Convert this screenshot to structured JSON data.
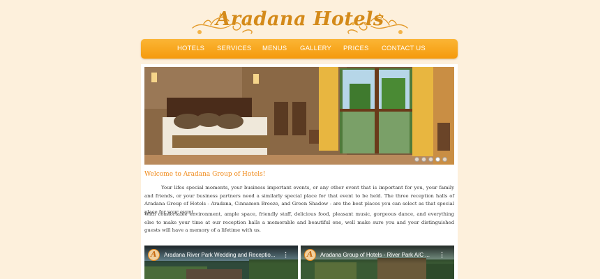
{
  "brand": {
    "name": "Aradana Hotels"
  },
  "nav": {
    "items": [
      {
        "label": "HOTELS"
      },
      {
        "label": "SERVICES"
      },
      {
        "label": "MENUS"
      },
      {
        "label": "GALLERY"
      },
      {
        "label": "PRICES"
      },
      {
        "label": "CONTACT US"
      }
    ]
  },
  "slider": {
    "slide_count": 5,
    "active_index": 3
  },
  "main": {
    "welcome_heading": "Welcome to Aradana Group of Hotels!",
    "paragraphs": [
      "Your lifes special moments, your business important events, or any other event that is important for you, your family and friends, or your business partners need a similarly special place for that event to be held. The three reception halls of Aradana Group of Hotels - Aradana, Cinnamon Breeze, and Green Shadow - are the best places you can select as that special place for your event.",
      "With comfortable environment, ample space, friendly staff, delicious food, pleasant music, gorgeous dance, and everything else to make your time at our reception halls a memorable and beautiful one, well make sure you and your distinguished guests will have a memory of a lifetime with us."
    ]
  },
  "videos": [
    {
      "title": "Aradana River Park Wedding and Receptio...",
      "menu_icon": "more-vert-icon"
    },
    {
      "title": "Aradana Group of Hotels - River Park A/C ...",
      "menu_icon": "more-vert-icon"
    }
  ],
  "colors": {
    "background": "#fdf0dc",
    "nav_orange": "#f7a41c",
    "accent_text": "#f08a1a",
    "logo_gold": "#d48a1a"
  }
}
